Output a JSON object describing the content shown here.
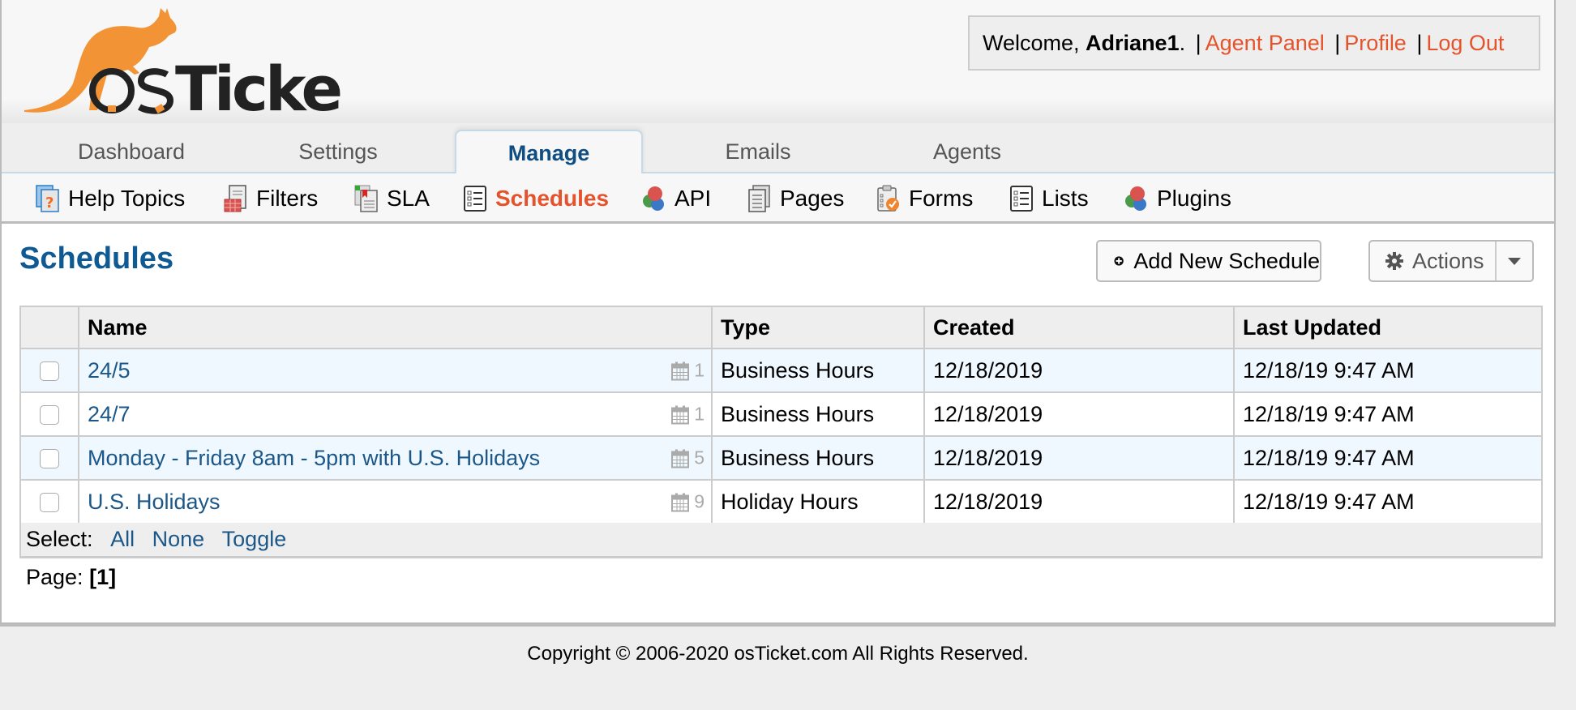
{
  "app": {
    "logo_text": "osTicket",
    "accent_color": "#e4532b",
    "heading_color": "#0f5a92"
  },
  "user_bar": {
    "welcome_prefix": "Welcome, ",
    "username": "Adriane1",
    "welcome_suffix": ".",
    "separator": "|",
    "links": [
      {
        "label": "Agent Panel"
      },
      {
        "label": "Profile"
      },
      {
        "label": "Log Out"
      }
    ]
  },
  "nav": {
    "tabs": [
      {
        "label": "Dashboard",
        "active": false
      },
      {
        "label": "Settings",
        "active": false
      },
      {
        "label": "Manage",
        "active": true
      },
      {
        "label": "Emails",
        "active": false
      },
      {
        "label": "Agents",
        "active": false
      }
    ]
  },
  "subnav": {
    "items": [
      {
        "label": "Help Topics",
        "icon": "help-topics-icon",
        "active": false
      },
      {
        "label": "Filters",
        "icon": "filters-icon",
        "active": false
      },
      {
        "label": "SLA",
        "icon": "sla-icon",
        "active": false
      },
      {
        "label": "Schedules",
        "icon": "schedules-icon",
        "active": true
      },
      {
        "label": "API",
        "icon": "api-icon",
        "active": false
      },
      {
        "label": "Pages",
        "icon": "pages-icon",
        "active": false
      },
      {
        "label": "Forms",
        "icon": "forms-icon",
        "active": false
      },
      {
        "label": "Lists",
        "icon": "lists-icon",
        "active": false
      },
      {
        "label": "Plugins",
        "icon": "plugins-icon",
        "active": false
      }
    ]
  },
  "page": {
    "title": "Schedules",
    "add_button": "Add New Schedule",
    "actions_button": "Actions"
  },
  "table": {
    "columns": [
      "Name",
      "Type",
      "Created",
      "Last Updated"
    ],
    "rows": [
      {
        "name": "24/5",
        "entries": "1",
        "type": "Business Hours",
        "created": "12/18/2019",
        "updated": "12/18/19 9:47 AM"
      },
      {
        "name": "24/7",
        "entries": "1",
        "type": "Business Hours",
        "created": "12/18/2019",
        "updated": "12/18/19 9:47 AM"
      },
      {
        "name": "Monday - Friday 8am - 5pm with U.S. Holidays",
        "entries": "5",
        "type": "Business Hours",
        "created": "12/18/2019",
        "updated": "12/18/19 9:47 AM"
      },
      {
        "name": "U.S. Holidays",
        "entries": "9",
        "type": "Holiday Hours",
        "created": "12/18/2019",
        "updated": "12/18/19 9:47 AM"
      }
    ],
    "select_label": "Select:",
    "select_links": [
      "All",
      "None",
      "Toggle"
    ]
  },
  "pagination": {
    "label": "Page:",
    "current": "[1]"
  },
  "footer": {
    "copyright": "Copyright © 2006-2020 osTicket.com All Rights Reserved."
  }
}
